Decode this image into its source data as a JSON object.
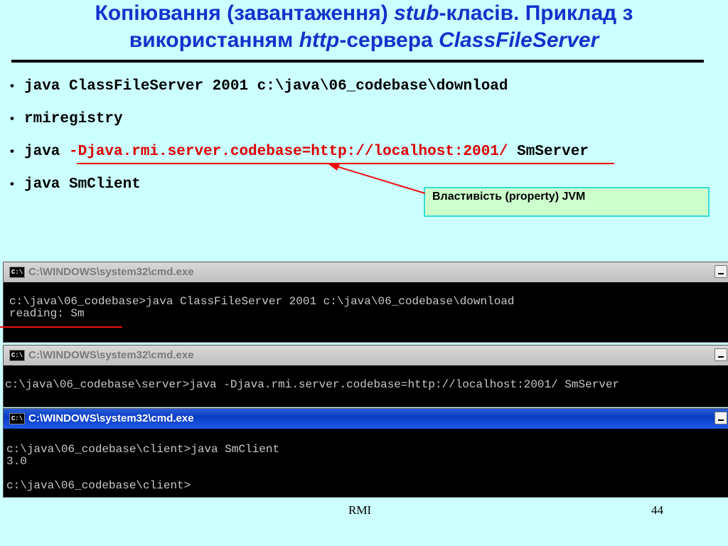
{
  "title": {
    "line1_part1": "Копіювання (завантаження) ",
    "line1_ital": "stub",
    "line1_part2": "-класів. Приклад з",
    "line2_part1": "використанням ",
    "line2_ital1": "http",
    "line2_part2": "-сервера ",
    "line2_ital2": "ClassFileServer"
  },
  "bullets": {
    "item1": "java ClassFileServer 2001 c:\\java\\06_codebase\\download",
    "item2": "rmiregistry",
    "item3_prefix": "java ",
    "item3_highlight": "-Djava.rmi.server.codebase=http://localhost:2001/",
    "item3_suffix": " SmServer",
    "item4": "java SmClient"
  },
  "callout": {
    "text": "Властивість (property) JVM"
  },
  "windows": [
    {
      "title": "C:\\WINDOWS\\system32\\cmd.exe",
      "lines": [
        "c:\\java\\06_codebase>java ClassFileServer 2001 c:\\java\\06_codebase\\download",
        "reading: Sm"
      ]
    },
    {
      "title": "C:\\WINDOWS\\system32\\cmd.exe",
      "lines": [
        "c:\\java\\06_codebase\\server>java -Djava.rmi.server.codebase=http://localhost:2001/ SmServer"
      ]
    },
    {
      "title": "C:\\WINDOWS\\system32\\cmd.exe",
      "lines": [
        "c:\\java\\06_codebase\\client>java SmClient",
        "3.0",
        "",
        "c:\\java\\06_codebase\\client>"
      ]
    }
  ],
  "app_icon_label": "C:\\",
  "footer": {
    "center": "RMI",
    "page": "44"
  },
  "colors": {
    "background": "#ccffff",
    "title": "#1133cc",
    "highlight": "#dd0000",
    "callout_bg": "#ccffcc",
    "callout_border": "#33dddd"
  }
}
